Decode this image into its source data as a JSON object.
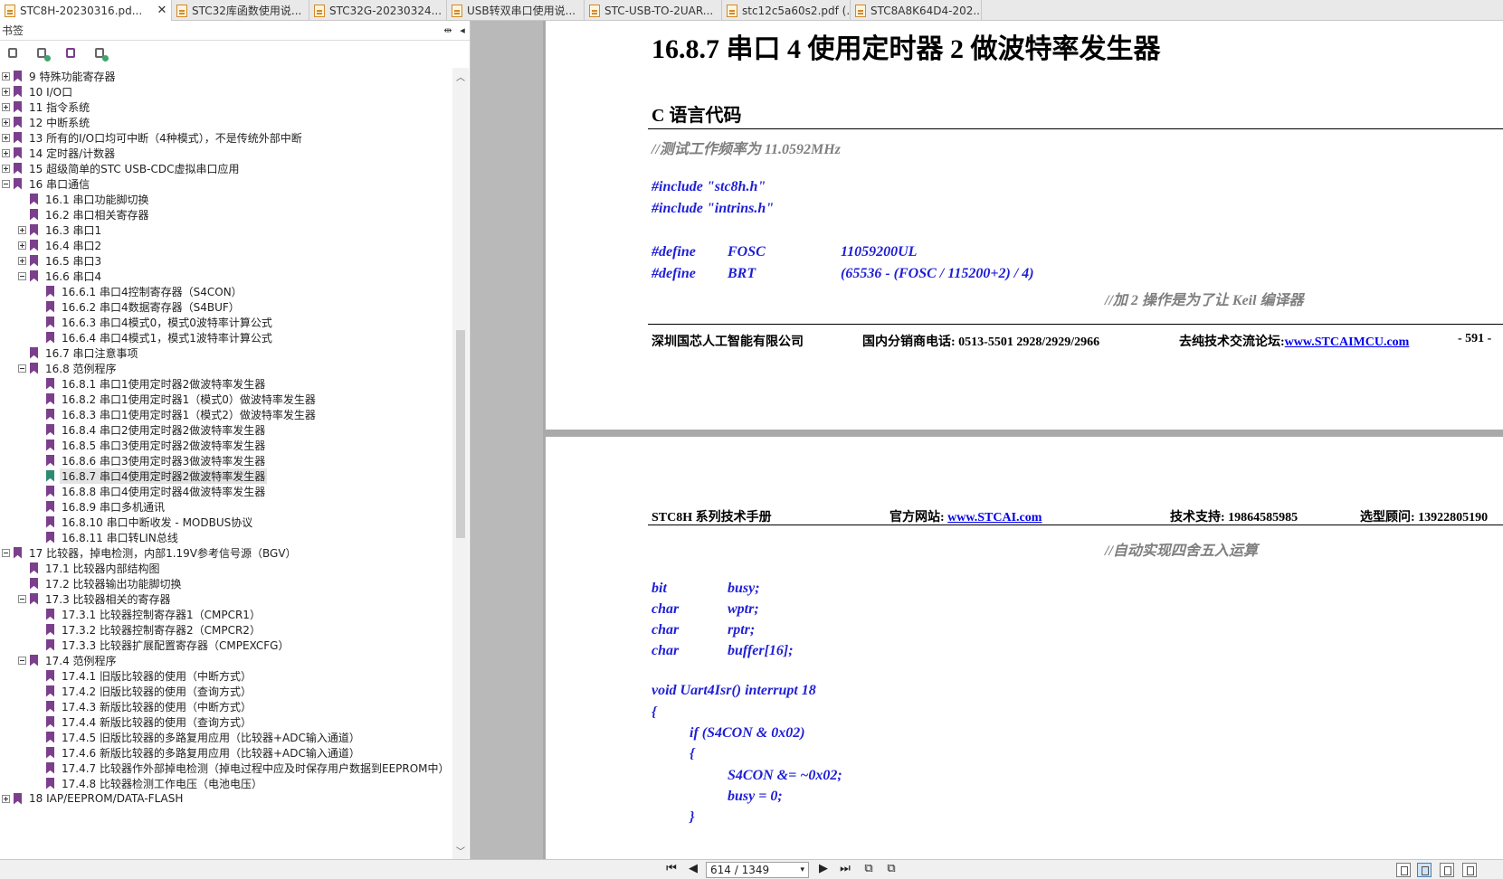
{
  "tabs": [
    {
      "label": "STC8H-20230316.pd...",
      "active": true,
      "close": "✕"
    },
    {
      "label": "STC32库函数使用说...",
      "active": false
    },
    {
      "label": "STC32G-20230324...",
      "active": false
    },
    {
      "label": "USB转双串口使用说...",
      "active": false
    },
    {
      "label": "STC-USB-TO-2UAR...",
      "active": false
    },
    {
      "label": "stc12c5a60s2.pdf (...",
      "active": false
    },
    {
      "label": "STC8A8K64D4-202...",
      "active": false
    }
  ],
  "panel": {
    "title": "书签",
    "collapse": "▸◂",
    "close": "◂"
  },
  "bookmarks": [
    {
      "level": 0,
      "exp": "plus",
      "label": "9 特殊功能寄存器"
    },
    {
      "level": 0,
      "exp": "plus",
      "label": "10 I/O口"
    },
    {
      "level": 0,
      "exp": "plus",
      "label": "11 指令系统"
    },
    {
      "level": 0,
      "exp": "plus",
      "label": "12 中断系统"
    },
    {
      "level": 0,
      "exp": "plus",
      "label": "13 所有的I/O口均可中断（4种模式），不是传统外部中断"
    },
    {
      "level": 0,
      "exp": "plus",
      "label": "14 定时器/计数器"
    },
    {
      "level": 0,
      "exp": "plus",
      "label": "15 超级简单的STC USB-CDC虚拟串口应用"
    },
    {
      "level": 0,
      "exp": "minus",
      "label": "16 串口通信"
    },
    {
      "level": 1,
      "exp": "none",
      "label": "16.1 串口功能脚切换"
    },
    {
      "level": 1,
      "exp": "none",
      "label": "16.2 串口相关寄存器"
    },
    {
      "level": 1,
      "exp": "plus",
      "label": "16.3 串口1"
    },
    {
      "level": 1,
      "exp": "plus",
      "label": "16.4 串口2"
    },
    {
      "level": 1,
      "exp": "plus",
      "label": "16.5 串口3"
    },
    {
      "level": 1,
      "exp": "minus",
      "label": "16.6 串口4"
    },
    {
      "level": 2,
      "exp": "none",
      "label": "16.6.1 串口4控制寄存器（S4CON）"
    },
    {
      "level": 2,
      "exp": "none",
      "label": "16.6.2 串口4数据寄存器（S4BUF）"
    },
    {
      "level": 2,
      "exp": "none",
      "label": "16.6.3 串口4模式0，模式0波特率计算公式"
    },
    {
      "level": 2,
      "exp": "none",
      "label": "16.6.4 串口4模式1，模式1波特率计算公式"
    },
    {
      "level": 1,
      "exp": "none",
      "label": "16.7 串口注意事项"
    },
    {
      "level": 1,
      "exp": "minus",
      "label": "16.8 范例程序"
    },
    {
      "level": 2,
      "exp": "none",
      "label": "16.8.1 串口1使用定时器2做波特率发生器"
    },
    {
      "level": 2,
      "exp": "none",
      "label": "16.8.2 串口1使用定时器1（模式0）做波特率发生器"
    },
    {
      "level": 2,
      "exp": "none",
      "label": "16.8.3 串口1使用定时器1（模式2）做波特率发生器"
    },
    {
      "level": 2,
      "exp": "none",
      "label": "16.8.4 串口2使用定时器2做波特率发生器"
    },
    {
      "level": 2,
      "exp": "none",
      "label": "16.8.5 串口3使用定时器2做波特率发生器"
    },
    {
      "level": 2,
      "exp": "none",
      "label": "16.8.6 串口3使用定时器3做波特率发生器"
    },
    {
      "level": 2,
      "exp": "none",
      "label": "16.8.7 串口4使用定时器2做波特率发生器",
      "selected": true
    },
    {
      "level": 2,
      "exp": "none",
      "label": "16.8.8 串口4使用定时器4做波特率发生器"
    },
    {
      "level": 2,
      "exp": "none",
      "label": "16.8.9 串口多机通讯"
    },
    {
      "level": 2,
      "exp": "none",
      "label": "16.8.10 串口中断收发 - MODBUS协议"
    },
    {
      "level": 2,
      "exp": "none",
      "label": "16.8.11 串口转LIN总线"
    },
    {
      "level": 0,
      "exp": "minus",
      "label": "17 比较器，掉电检测，内部1.19V参考信号源（BGV）"
    },
    {
      "level": 1,
      "exp": "none",
      "label": "17.1 比较器内部结构图"
    },
    {
      "level": 1,
      "exp": "none",
      "label": "17.2 比较器输出功能脚切换"
    },
    {
      "level": 1,
      "exp": "minus",
      "label": "17.3 比较器相关的寄存器"
    },
    {
      "level": 2,
      "exp": "none",
      "label": "17.3.1 比较器控制寄存器1（CMPCR1）"
    },
    {
      "level": 2,
      "exp": "none",
      "label": "17.3.2 比较器控制寄存器2（CMPCR2）"
    },
    {
      "level": 2,
      "exp": "none",
      "label": "17.3.3 比较器扩展配置寄存器（CMPEXCFG）"
    },
    {
      "level": 1,
      "exp": "minus",
      "label": "17.4 范例程序"
    },
    {
      "level": 2,
      "exp": "none",
      "label": "17.4.1 旧版比较器的使用（中断方式）"
    },
    {
      "level": 2,
      "exp": "none",
      "label": "17.4.2 旧版比较器的使用（查询方式）"
    },
    {
      "level": 2,
      "exp": "none",
      "label": "17.4.3 新版比较器的使用（中断方式）"
    },
    {
      "level": 2,
      "exp": "none",
      "label": "17.4.4 新版比较器的使用（查询方式）"
    },
    {
      "level": 2,
      "exp": "none",
      "label": "17.4.5 旧版比较器的多路复用应用（比较器+ADC输入通道）"
    },
    {
      "level": 2,
      "exp": "none",
      "label": "17.4.6 新版比较器的多路复用应用（比较器+ADC输入通道）"
    },
    {
      "level": 2,
      "exp": "none",
      "label": "17.4.7 比较器作外部掉电检测（掉电过程中应及时保存用户数据到EEPROM中）"
    },
    {
      "level": 2,
      "exp": "none",
      "label": "17.4.8 比较器检测工作电压（电池电压）"
    },
    {
      "level": 0,
      "exp": "plus",
      "label": "18 IAP/EEPROM/DATA-FLASH"
    }
  ],
  "page1": {
    "section_title": "16.8.7     串口 4 使用定时器 2 做波特率发生器",
    "sub_title": "C 语言代码",
    "comment1": "//测试工作频率为 11.0592MHz",
    "include1": "#include \"stc8h.h\"",
    "include2": "#include \"intrins.h\"",
    "define_kw": "#define",
    "fosc_name": "FOSC",
    "fosc_val": "11059200UL",
    "brt_name": "BRT",
    "brt_val": "(65536 - (FOSC / 115200+2) / 4)",
    "comment2": "//加 2 操作是为了让 Keil 编译器",
    "footer_company": "深圳国芯人工智能有限公司",
    "footer_phone": "国内分销商电话: 0513-5501 2928/2929/2966",
    "footer_forum": "去纯技术交流论坛:",
    "footer_forum_link": "www.STCAIMCU.com",
    "footer_page": "- 591 -"
  },
  "page2": {
    "hdr_manual": "STC8H 系列技术手册",
    "hdr_site": "官方网站: ",
    "hdr_site_link": "www.STCAI.com",
    "hdr_support": "技术支持: 19864585985",
    "hdr_consult": "选型顾问: 13922805190",
    "comment3": "//自动实现四舍五入运算",
    "vars": [
      {
        "type": "bit",
        "name": "busy;"
      },
      {
        "type": "char",
        "name": "wptr;"
      },
      {
        "type": "char",
        "name": "rptr;"
      },
      {
        "type": "char",
        "name": "buffer[16];"
      }
    ],
    "fn_sig": "void Uart4Isr() interrupt 18",
    "brace_open": "{",
    "if_line": "if (S4CON & 0x02)",
    "brace_open2": "{",
    "s4con_line": "S4CON &= ~0x02;",
    "busy_line": "busy = 0;",
    "brace_close2": "}"
  },
  "status": {
    "page_field": "614 / 1349",
    "dropdown": "▾"
  }
}
